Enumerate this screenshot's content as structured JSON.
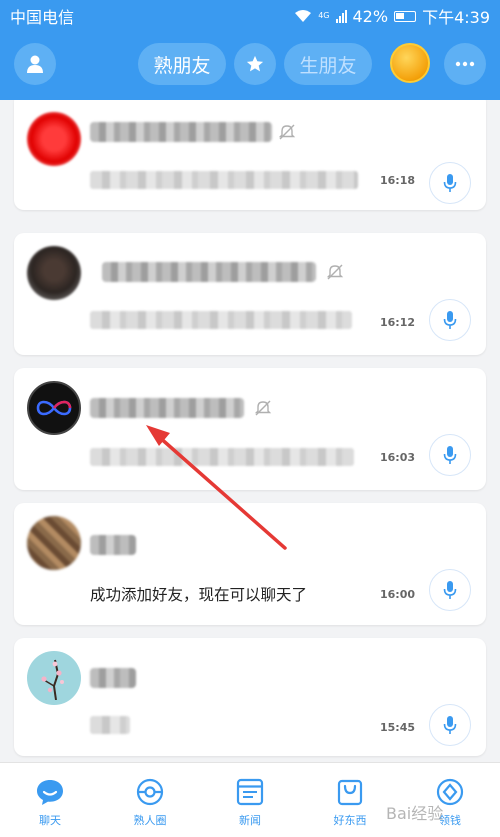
{
  "status_bar": {
    "carrier": "中国电信",
    "network": "4G",
    "battery": "42%",
    "time": "下午4:39"
  },
  "header": {
    "tab_familiar": "熟朋友",
    "tab_stranger": "生朋友",
    "profile_icon": "person-icon",
    "star_icon": "star-icon",
    "more_icon": "more-icon"
  },
  "chats": [
    {
      "time": "16:18",
      "muted": true,
      "message": ""
    },
    {
      "time": "16:12",
      "muted": true,
      "message": ""
    },
    {
      "time": "16:03",
      "muted": true,
      "message": ""
    },
    {
      "time": "16:00",
      "muted": false,
      "message": "成功添加好友，现在可以聊天了"
    },
    {
      "time": "15:45",
      "muted": false,
      "message": ""
    }
  ],
  "tabs": [
    {
      "label": "聊天",
      "icon": "chat-bubble-icon"
    },
    {
      "label": "熟人圈",
      "icon": "circle-icon"
    },
    {
      "label": "新闻",
      "icon": "news-icon"
    },
    {
      "label": "好东西",
      "icon": "shopping-bag-icon"
    },
    {
      "label": "领钱",
      "icon": "money-icon"
    }
  ],
  "watermark": "Bai经验",
  "colors": {
    "primary": "#3a9af0",
    "header_button": "#5eb0f4",
    "annotation_arrow": "#e53935"
  }
}
